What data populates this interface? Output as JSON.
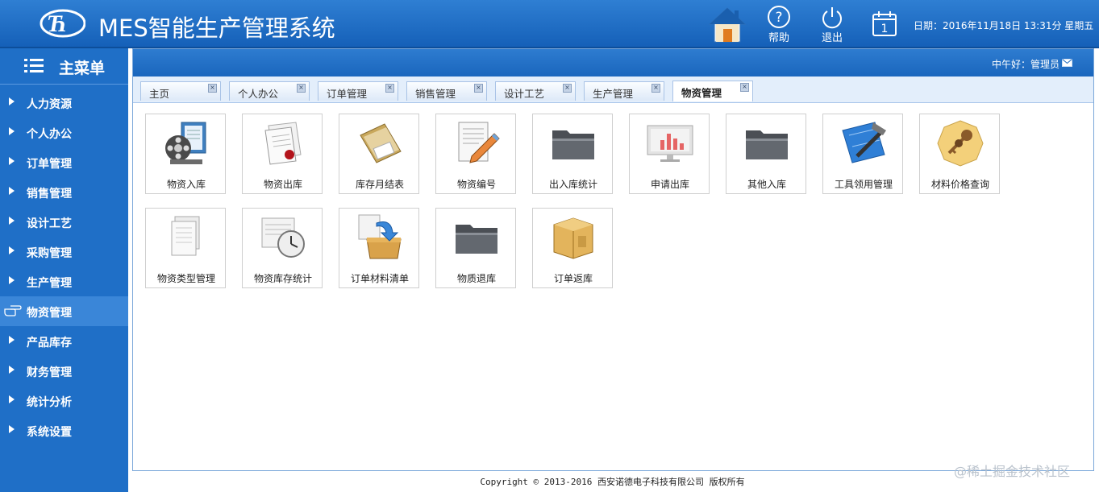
{
  "header": {
    "title": "MES智能生产管理系统",
    "buttons": [
      {
        "label": "帮助",
        "icon": "help-icon"
      },
      {
        "label": "退出",
        "icon": "power-icon"
      }
    ],
    "date_text": "日期：2016年11月18日 13:31分 星期五"
  },
  "sidebar": {
    "title": "主菜单",
    "items": [
      {
        "label": "人力资源"
      },
      {
        "label": "个人办公"
      },
      {
        "label": "订单管理"
      },
      {
        "label": "销售管理"
      },
      {
        "label": "设计工艺"
      },
      {
        "label": "采购管理"
      },
      {
        "label": "生产管理"
      },
      {
        "label": "物资管理",
        "active": true
      },
      {
        "label": "产品库存"
      },
      {
        "label": "财务管理"
      },
      {
        "label": "统计分析"
      },
      {
        "label": "系统设置"
      }
    ]
  },
  "content": {
    "greeting": "中午好：管理员",
    "tabs": [
      {
        "label": "主页"
      },
      {
        "label": "个人办公"
      },
      {
        "label": "订单管理"
      },
      {
        "label": "销售管理"
      },
      {
        "label": "设计工艺"
      },
      {
        "label": "生产管理"
      },
      {
        "label": "物资管理",
        "active": true
      }
    ],
    "tiles": [
      {
        "label": "物资入库",
        "icon": "film-document-icon"
      },
      {
        "label": "物资出库",
        "icon": "certificate-scroll-icon"
      },
      {
        "label": "库存月结表",
        "icon": "folder-papers-icon"
      },
      {
        "label": "物资编号",
        "icon": "document-pencil-icon"
      },
      {
        "label": "出入库统计",
        "icon": "dark-folder-icon"
      },
      {
        "label": "申请出库",
        "icon": "monitor-chart-icon"
      },
      {
        "label": "其他入库",
        "icon": "dark-folder-icon"
      },
      {
        "label": "工具领用管理",
        "icon": "blueprint-hammer-icon"
      },
      {
        "label": "材料价格查询",
        "icon": "keys-icon"
      },
      {
        "label": "物资类型管理",
        "icon": "documents-stack-icon"
      },
      {
        "label": "物资库存统计",
        "icon": "clock-document-icon"
      },
      {
        "label": "订单材料清单",
        "icon": "box-arrow-icon"
      },
      {
        "label": "物质退库",
        "icon": "dark-folder-icon"
      },
      {
        "label": "订单返库",
        "icon": "cardboard-box-icon"
      }
    ]
  },
  "footer": {
    "copyright": "Copyright © 2013-2016 西安诺德电子科技有限公司 版权所有"
  },
  "watermark": "@稀土掘金技术社区",
  "colors": {
    "header_blue": "#1f6fc7",
    "sidebar_blue": "#1f6fc7",
    "active_item": "#3a86d8"
  }
}
